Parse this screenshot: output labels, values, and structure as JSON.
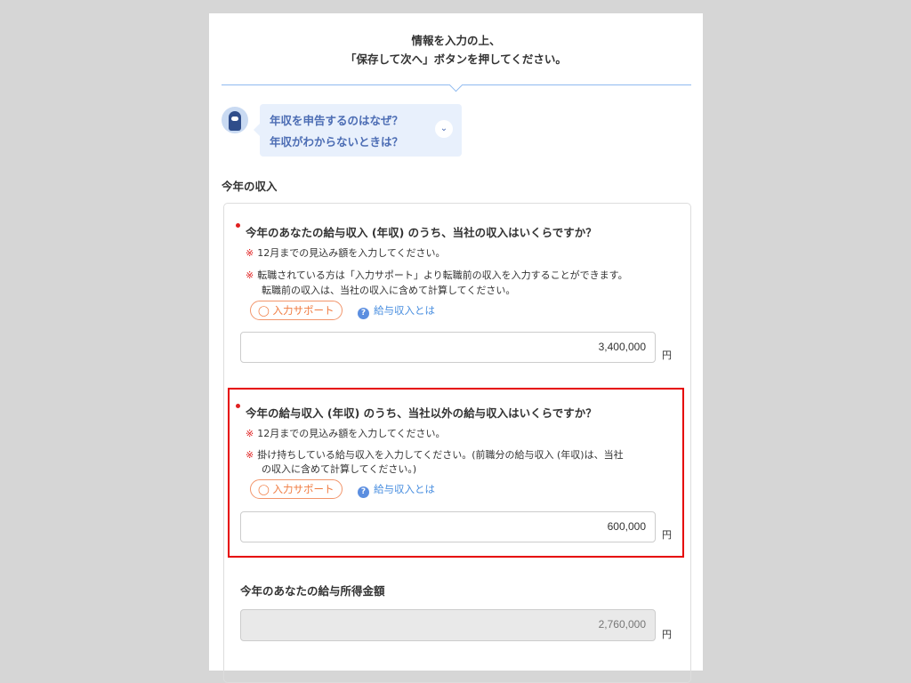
{
  "header": {
    "line1": "情報を入力の上、",
    "line2": "「保存して次へ」ボタンを押してください。"
  },
  "help_bubble": {
    "line1": "年収を申告するのはなぜ？",
    "line2": "年収がわからないときは？"
  },
  "section_title": "今年の収入",
  "questions": [
    {
      "title": "今年のあなたの給与収入 (年収) のうち、当社の収入はいくらですか？",
      "mark": "※",
      "notes": [
        "12月までの見込み額を入力してください。",
        "転職されている方は「入力サポート」より転職前の収入を入力することができます。",
        "転職前の収入は、当社の収入に含めて計算してください。"
      ],
      "support_label": "入力サポート",
      "help_link": "給与収入とは",
      "value": "3,400,000",
      "unit": "円"
    },
    {
      "title": "今年の給与収入 (年収) のうち、当社以外の給与収入はいくらですか？",
      "mark": "※",
      "notes": [
        "12月までの見込み額を入力してください。",
        "掛け持ちしている給与収入を入力してください。(前職分の給与収入 (年収)は、当社",
        "の収入に含めて計算してください。)"
      ],
      "support_label": "入力サポート",
      "help_link": "給与収入とは",
      "value": "600,000",
      "unit": "円"
    }
  ],
  "salary_income": {
    "label": "今年のあなたの給与所得金額",
    "value": "2,760,000",
    "unit": "円"
  },
  "colors": {
    "required": "#e02020",
    "highlight": "#e60000",
    "link": "#4a8fe0",
    "support": "#f07a3f"
  }
}
